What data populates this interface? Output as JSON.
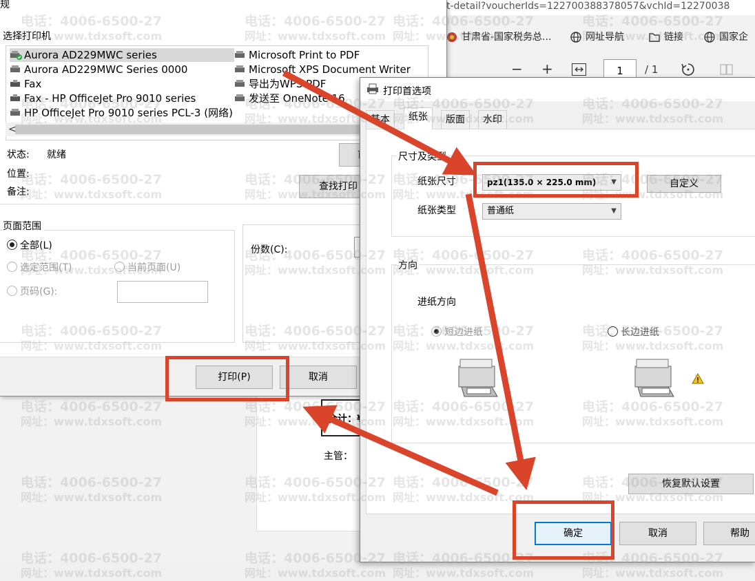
{
  "browser": {
    "url": "t-detail?voucherIds=122700388378057&vchId=12270038",
    "bookmarks": [
      {
        "label": "甘肃省-国家税务总...",
        "icon": "tax-bureau-icon"
      },
      {
        "label": "网址导航",
        "icon": "globe-icon"
      },
      {
        "label": "链接",
        "icon": "folder-icon"
      },
      {
        "label": "国家企",
        "icon": "globe-icon"
      }
    ],
    "pdf": {
      "zoom_out": "−",
      "zoom_in": "+",
      "fit": "↔",
      "page": "1",
      "total": "/ 1"
    }
  },
  "doc": {
    "total": "合计：",
    "total_suffix": "¥",
    "manager": "主管："
  },
  "print_dialog": {
    "tab_label": "规",
    "select_printer": "选择打印机",
    "printers_col1": [
      "Aurora AD229MWC series",
      "Aurora AD229MWC Series 0000",
      "Fax",
      "Fax - HP OfficeJet Pro 9010 series",
      "HP OfficeJet Pro 9010 series PCL-3 (网络)"
    ],
    "printers_col2": [
      "Microsoft Print to PDF",
      "Microsoft XPS Document Writer",
      "导出为WPS PDF",
      "发送至 OneNote 16"
    ],
    "status_label": "状态:",
    "status_value": "就绪",
    "location_label": "位置:",
    "comment_label": "备注:",
    "preferences_btn": "首",
    "find_printer_btn": "查找打印",
    "page_range": "页面范围",
    "range_all": "全部(L)",
    "range_selection": "选定范围(T)",
    "range_current": "当前页面(U)",
    "range_pages": "页码(G):",
    "copies": "份数(C):",
    "print_btn": "打印(P)",
    "cancel_btn": "取消"
  },
  "pref_dialog": {
    "title": "打印首选项",
    "tabs": [
      "基本",
      "纸张",
      "版面",
      "水印"
    ],
    "active_tab": "纸张",
    "size_group": "尺寸及类型",
    "paper_size_label": "纸张尺寸",
    "paper_size_value": "pz1(135.0 × 225.0 mm)",
    "paper_type_label": "纸张类型",
    "paper_type_value": "普通纸",
    "custom_btn": "自定义",
    "orientation_group": "方向",
    "feed_label": "进纸方向",
    "feed_short": "短边进纸",
    "feed_long": "长边进纸",
    "reset_btn": "恢复默认设置",
    "ok_btn": "确定",
    "cancel_btn": "取消",
    "help_btn": "帮助"
  },
  "watermark": {
    "phone": "电话：4006-6500-27",
    "site": "网址：www.tdxsoft.com"
  },
  "colors": {
    "annotation_red": "#d9442b",
    "ok_focus_blue": "#0078d7"
  }
}
